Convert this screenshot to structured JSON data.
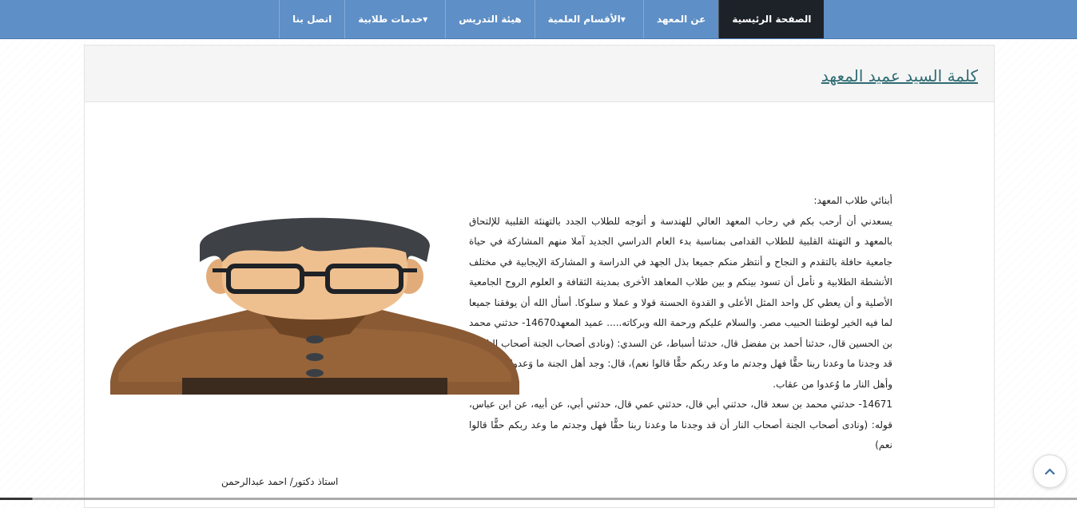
{
  "nav": {
    "items": [
      {
        "label": "الصفحة الرئيسية",
        "active": true,
        "dropdown": false
      },
      {
        "label": "عن المعهد",
        "active": false,
        "dropdown": false
      },
      {
        "label": "الأقسام العلمية",
        "active": false,
        "dropdown": true
      },
      {
        "label": "هيئة التدريس",
        "active": false,
        "dropdown": false
      },
      {
        "label": "خدمات طلابية",
        "active": false,
        "dropdown": true
      },
      {
        "label": "اتصل بنا",
        "active": false,
        "dropdown": false
      }
    ],
    "caret_icon": "chevron-down-icon",
    "bar_color": "#5e8fc6",
    "active_color": "#1d2229"
  },
  "article": {
    "title": "كلمة السيد عميد المعهد",
    "title_color": "#2f6c73",
    "greeting": "أبنائي طلاب المعهد:",
    "paragraph1": "يسعدني أن أرحب بكم في رحاب المعهد العالي للهندسة و أتوجه للطلاب الجدد بالتهنئة القلبية للإلتحاق بالمعهد و التهنئة القلبية للطلاب القدامى بمناسبة بدء العام الدراسي الجديد آملا منهم المشاركة في حياة جامعية حافلة بالتقدم و النجاح و أنتظر منكم جميعا بذل الجهد في الدراسة و المشاركة الإيجابية في مختلف الأنشطة الطلابية و نأمل أن تسود بينكم و بين طلاب المعاهد الأخرى بمدينة الثقافة و العلوم الروح الجامعية الأصلية و أن يعطي كل واحد المثل الأعلى و القدوة الحسنة قولا و عملا و سلوكا. أسأل الله أن يوفقنا جميعا لما فيه الخير لوطننا الحبيب مصر. والسلام عليكم ورحمة الله وبركاته..... عميد المعهد14670- حدثني محمد بن الحسين قال، حدثنا أحمد بن مفضل قال، حدثنا أسباط، عن السدي: (ونادى أصحاب الجنة أصحاب النار أن قد وجدنا ما وعدنا ربنا حقًّا فهل وجدتم ما وعد ربكم حقًّا قالوا نعم)، قال: وجد أهل الجنة ما وَعدوا من ثواب، وأهل النار ما وُعدوا من عقاب.",
    "paragraph2": "14671- حدثني محمد بن سعد قال، حدثني أبي قال، حدثني عمي قال، حدثني أبي، عن أبيه، عن ابن عباس، قوله: (ونادى أصحاب الجنة أصحاب النار أن قد وجدنا ما وعدنا ربنا حقًّا فهل وجدتم ما وعد ربكم حقًّا قالوا نعم)"
  },
  "profile": {
    "image": "person-avatar-icon",
    "caption": "استاذ دكتور/ احمد عبدالرحمن"
  },
  "scroll_top": {
    "icon": "chevron-up-icon"
  }
}
